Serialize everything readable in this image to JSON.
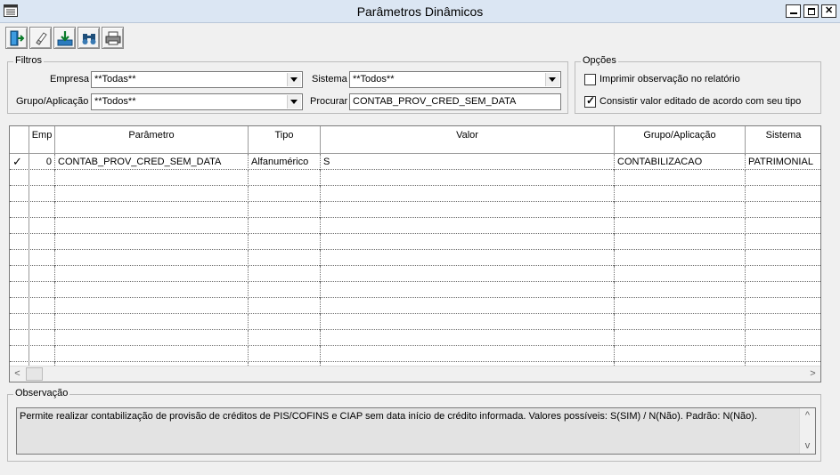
{
  "window": {
    "title": "Parâmetros Dinâmicos"
  },
  "toolbar": {
    "buttons": [
      {
        "icon": "exit-door-icon"
      },
      {
        "icon": "eraser-icon"
      },
      {
        "icon": "save-download-icon"
      },
      {
        "icon": "binoculars-icon"
      },
      {
        "icon": "printer-icon"
      }
    ]
  },
  "filtros": {
    "legend": "Filtros",
    "empresa_label": "Empresa",
    "empresa_value": "**Todas**",
    "sistema_label": "Sistema",
    "sistema_value": "**Todos**",
    "grupo_label": "Grupo/Aplicação",
    "grupo_value": "**Todos**",
    "procurar_label": "Procurar",
    "procurar_value": "CONTAB_PROV_CRED_SEM_DATA"
  },
  "opcoes": {
    "legend": "Opções",
    "imprimir_label": "Imprimir observação no relatório",
    "imprimir_checked": false,
    "consistir_label": "Consistir valor editado de acordo com seu tipo",
    "consistir_checked": true
  },
  "grid": {
    "columns": [
      "Emp",
      "Parâmetro",
      "Tipo",
      "Valor",
      "Grupo/Aplicação",
      "Sistema"
    ],
    "rows": [
      {
        "selected": true,
        "emp": "0",
        "parametro": "CONTAB_PROV_CRED_SEM_DATA",
        "tipo": "Alfanumérico",
        "valor": "S",
        "grupo": "CONTABILIZACAO",
        "sistema": "PATRIMONIAL"
      }
    ]
  },
  "observacao": {
    "legend": "Observação",
    "text": "Permite realizar contabilização de provisão de créditos de PIS/COFINS e CIAP sem data início de crédito informada. Valores possíveis: S(SIM) / N(Não). Padrão: N(Não)."
  }
}
